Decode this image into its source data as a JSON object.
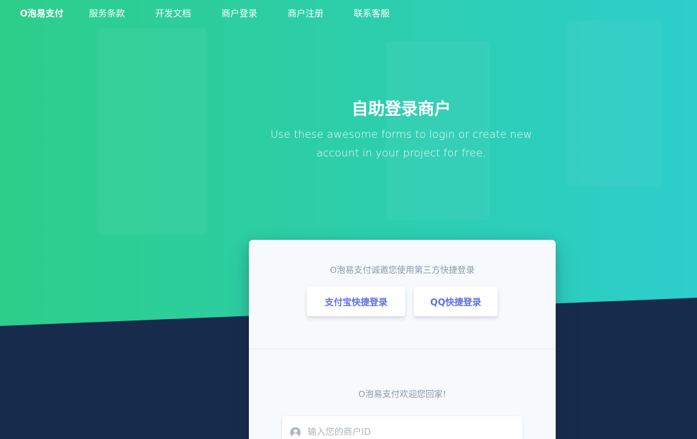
{
  "navbar": {
    "brand": "O泡易支付",
    "links": [
      "服务条款",
      "开发文档",
      "商户登录",
      "商户注册",
      "联系客服"
    ]
  },
  "hero": {
    "title": "自助登录商户",
    "lead_line1": "Use these awesome forms to login or create new",
    "lead_line2": "account in your project for free."
  },
  "card": {
    "header_text": "O泡易支付诚邀您使用第三方快捷登录",
    "alipay_button": "支付宝快捷登录",
    "qq_button": "QQ快捷登录",
    "welcome_text": "O泡易支付欢迎您回家!",
    "merchant_id_placeholder": "输入您的商户ID"
  },
  "colors": {
    "gradient_start": "#2dce89",
    "gradient_end": "#2dcecc",
    "dark_bg": "#172b4d",
    "accent": "#5e72e4"
  },
  "icons": {
    "input_icon": "user-circle-icon"
  }
}
